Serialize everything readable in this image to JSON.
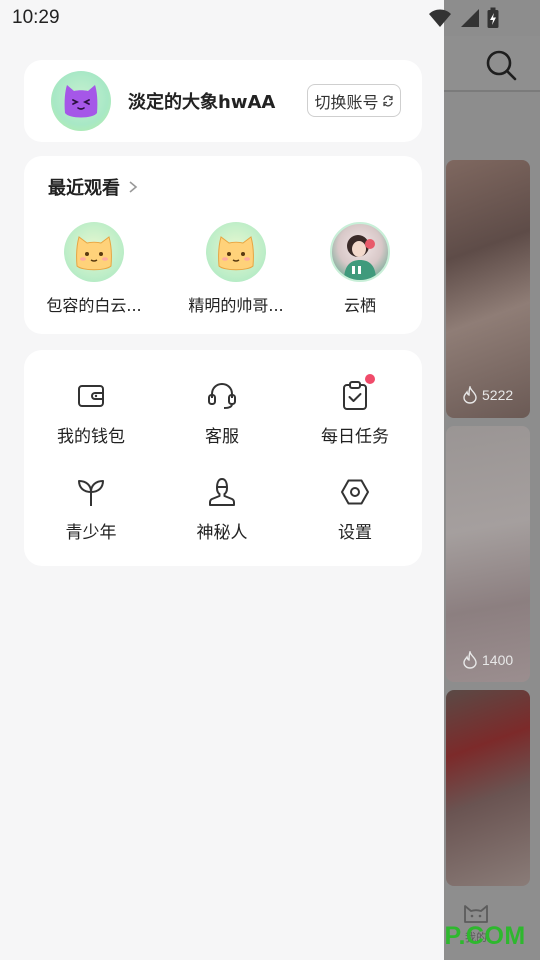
{
  "status_bar": {
    "time": "10:29"
  },
  "profile": {
    "username": "淡定的大象hwAA",
    "switch_label": "切换账号"
  },
  "recent": {
    "title": "最近观看",
    "items": [
      {
        "name": "包容的白云..."
      },
      {
        "name": "精明的帅哥..."
      },
      {
        "name": "云栖"
      }
    ]
  },
  "menu": {
    "items": [
      {
        "label": "我的钱包",
        "icon": "wallet-icon"
      },
      {
        "label": "客服",
        "icon": "headset-icon"
      },
      {
        "label": "每日任务",
        "icon": "clipboard-check-icon",
        "badge": true
      },
      {
        "label": "青少年",
        "icon": "sprout-icon"
      },
      {
        "label": "神秘人",
        "icon": "mystery-person-icon"
      },
      {
        "label": "设置",
        "icon": "hexagon-settings-icon"
      }
    ]
  },
  "background": {
    "heat_counts": [
      "5222",
      "1400"
    ],
    "tab_label": "我的"
  },
  "watermark": "ITMOP.COM",
  "colors": {
    "accent_badge": "#f04b6a",
    "drawer_bg": "#f6f6f7",
    "card_bg": "#ffffff"
  }
}
